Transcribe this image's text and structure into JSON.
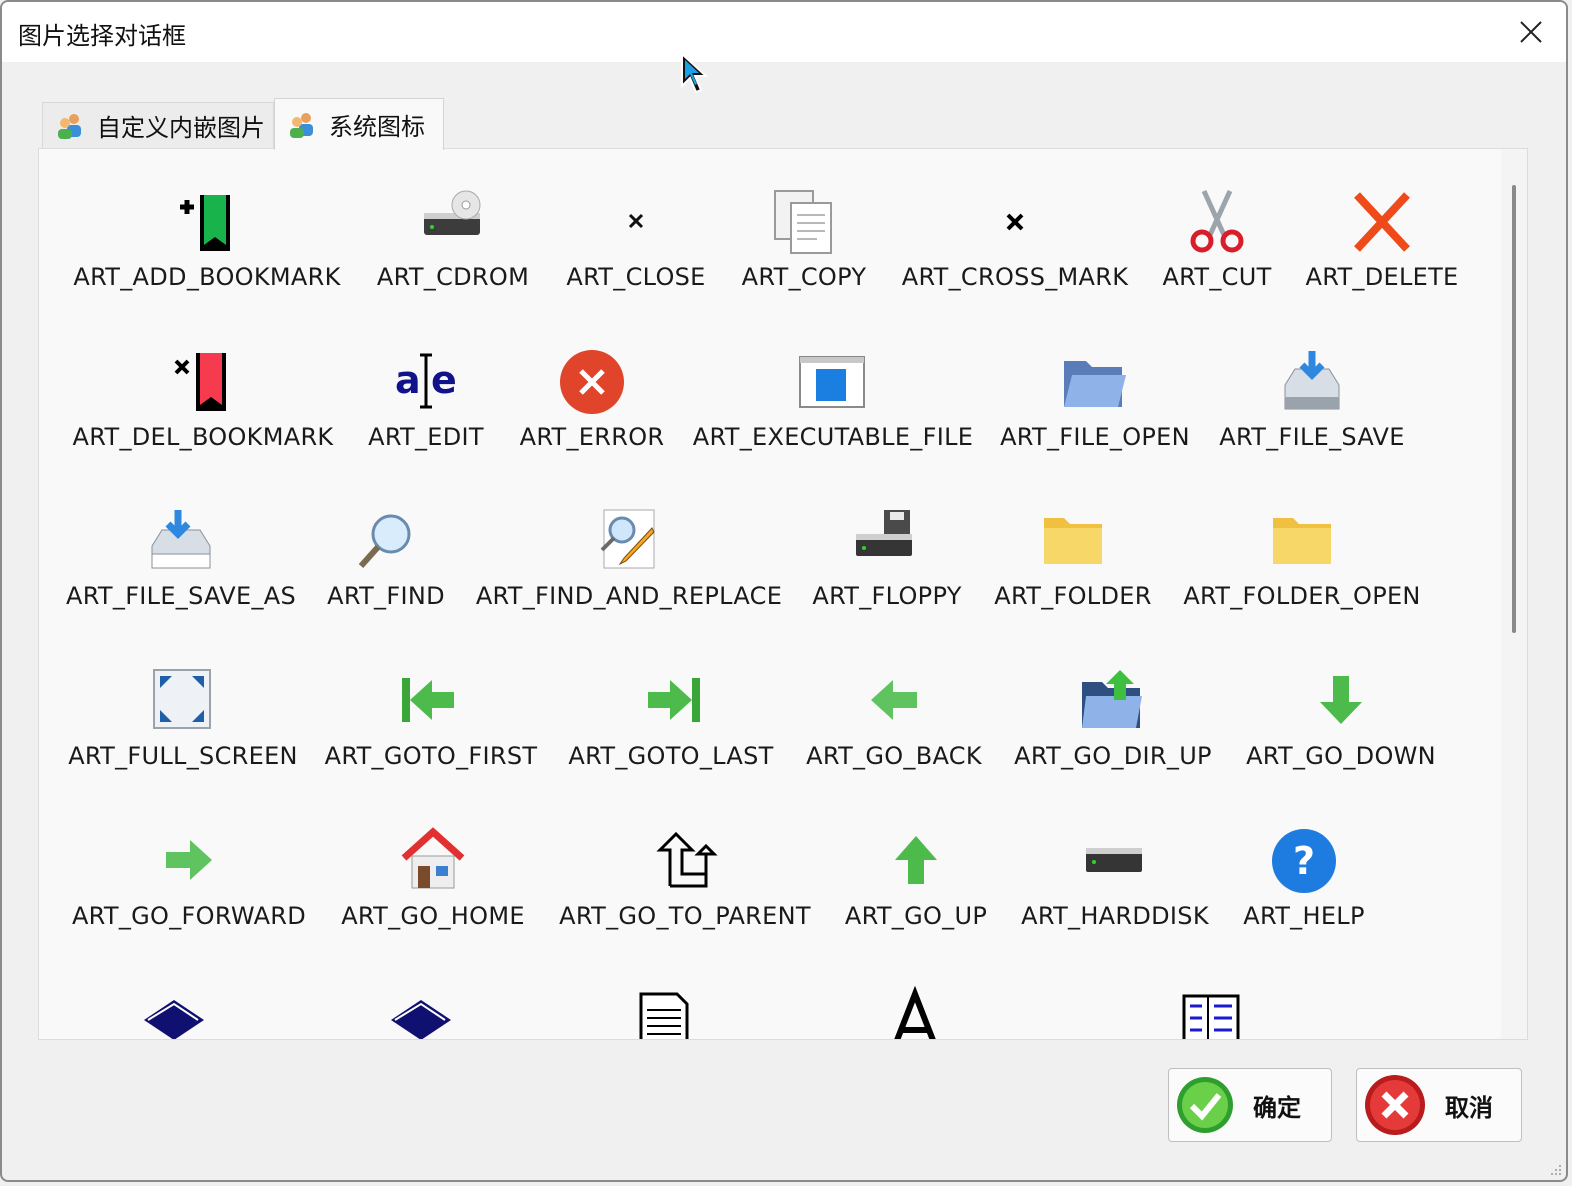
{
  "window": {
    "title": "图片选择对话框"
  },
  "tabs": [
    {
      "label": "自定义内嵌图片",
      "active": false,
      "icon": "users-icon"
    },
    {
      "label": "系统图标",
      "active": true,
      "icon": "users-icon"
    }
  ],
  "icons": [
    {
      "label": "ART_ADD_BOOKMARK",
      "icon": "add-bookmark-icon"
    },
    {
      "label": "ART_CDROM",
      "icon": "cdrom-icon"
    },
    {
      "label": "ART_CLOSE",
      "icon": "close-icon"
    },
    {
      "label": "ART_COPY",
      "icon": "copy-icon"
    },
    {
      "label": "ART_CROSS_MARK",
      "icon": "cross-mark-icon"
    },
    {
      "label": "ART_CUT",
      "icon": "cut-icon"
    },
    {
      "label": "ART_DELETE",
      "icon": "delete-icon"
    },
    {
      "label": "ART_DEL_BOOKMARK",
      "icon": "del-bookmark-icon"
    },
    {
      "label": "ART_EDIT",
      "icon": "edit-icon"
    },
    {
      "label": "ART_ERROR",
      "icon": "error-icon"
    },
    {
      "label": "ART_EXECUTABLE_FILE",
      "icon": "executable-file-icon"
    },
    {
      "label": "ART_FILE_OPEN",
      "icon": "file-open-icon"
    },
    {
      "label": "ART_FILE_SAVE",
      "icon": "file-save-icon"
    },
    {
      "label": "ART_FILE_SAVE_AS",
      "icon": "file-save-as-icon"
    },
    {
      "label": "ART_FIND",
      "icon": "find-icon"
    },
    {
      "label": "ART_FIND_AND_REPLACE",
      "icon": "find-and-replace-icon"
    },
    {
      "label": "ART_FLOPPY",
      "icon": "floppy-icon"
    },
    {
      "label": "ART_FOLDER",
      "icon": "folder-icon"
    },
    {
      "label": "ART_FOLDER_OPEN",
      "icon": "folder-open-icon"
    },
    {
      "label": "ART_FULL_SCREEN",
      "icon": "full-screen-icon"
    },
    {
      "label": "ART_GOTO_FIRST",
      "icon": "goto-first-icon"
    },
    {
      "label": "ART_GOTO_LAST",
      "icon": "goto-last-icon"
    },
    {
      "label": "ART_GO_BACK",
      "icon": "go-back-icon"
    },
    {
      "label": "ART_GO_DIR_UP",
      "icon": "go-dir-up-icon"
    },
    {
      "label": "ART_GO_DOWN",
      "icon": "go-down-icon"
    },
    {
      "label": "ART_GO_FORWARD",
      "icon": "go-forward-icon"
    },
    {
      "label": "ART_GO_HOME",
      "icon": "go-home-icon"
    },
    {
      "label": "ART_GO_TO_PARENT",
      "icon": "go-to-parent-icon"
    },
    {
      "label": "ART_GO_UP",
      "icon": "go-up-icon"
    },
    {
      "label": "ART_HARDDISK",
      "icon": "harddisk-icon"
    },
    {
      "label": "ART_HELP",
      "icon": "help-icon"
    }
  ],
  "partial_icons": [
    "help-book-icon",
    "help-book-icon",
    "report-view-icon",
    "font-icon",
    "list-view-icon"
  ],
  "buttons": {
    "ok_label": "确定",
    "cancel_label": "取消"
  },
  "colors": {
    "accent_green": "#3aa63a",
    "error_red": "#e0442a",
    "help_blue": "#1e7be0",
    "folder_yellow": "#f7d768"
  }
}
